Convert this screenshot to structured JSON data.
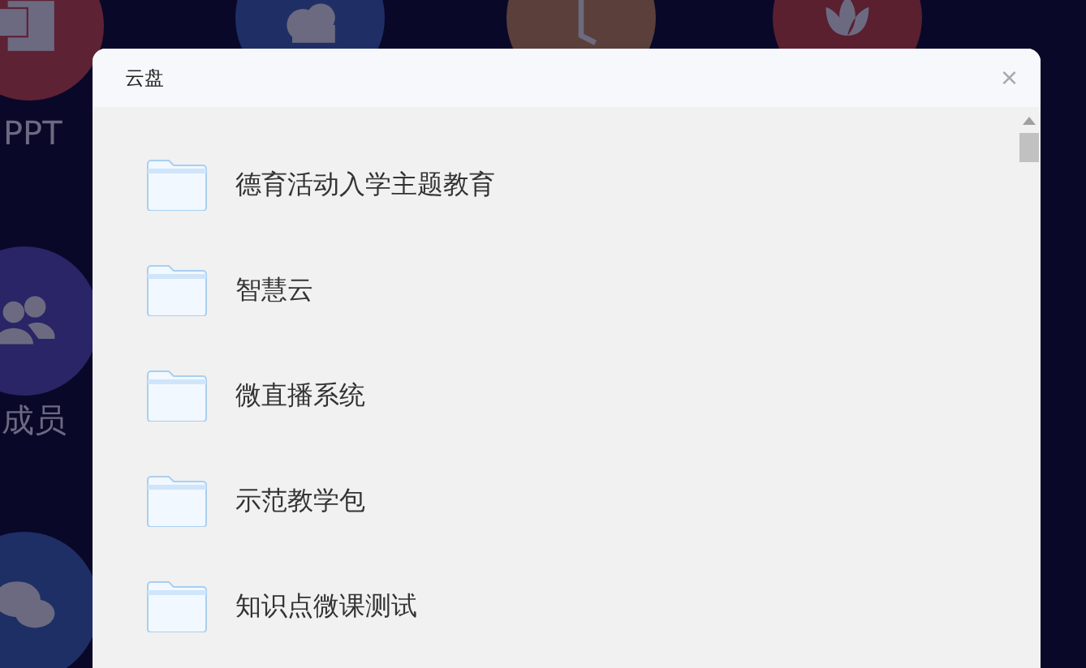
{
  "desktop": {
    "apps": [
      {
        "label": "PPT",
        "color": "#5e2235",
        "kind": "ppt"
      },
      {
        "label": "成员",
        "color": "#2a2566",
        "kind": "people"
      },
      {
        "color": "#1e2f66",
        "kind": "chat"
      },
      {
        "color": "#1f2f66",
        "kind": "cloud"
      },
      {
        "color": "#5a3f3a",
        "kind": "clock"
      },
      {
        "color": "#5a2030",
        "kind": "lotus"
      }
    ]
  },
  "dialog": {
    "title": "云盘",
    "close": "×",
    "folders": [
      {
        "name": "德育活动入学主题教育"
      },
      {
        "name": "智慧云"
      },
      {
        "name": "微直播系统"
      },
      {
        "name": "示范教学包"
      },
      {
        "name": "知识点微课测试"
      }
    ]
  }
}
